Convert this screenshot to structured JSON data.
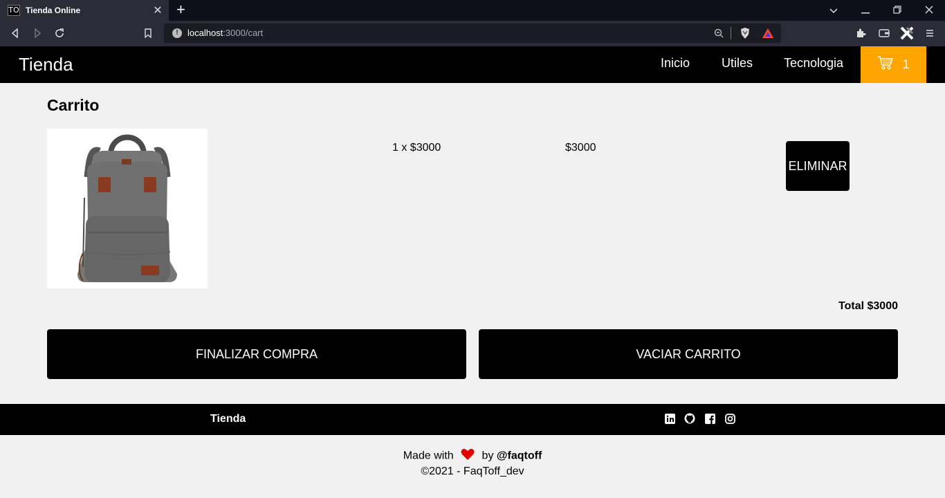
{
  "browser": {
    "tab_favicon": "TO",
    "tab_title": "Tienda Online",
    "url_host": "localhost",
    "url_path": ":3000/cart"
  },
  "header": {
    "brand": "Tienda",
    "nav": [
      "Inicio",
      "Utiles",
      "Tecnologia"
    ],
    "cart_count": "1",
    "cart_color": "#ffa500"
  },
  "cart": {
    "title": "Carrito",
    "items": [
      {
        "image": "gray-backpack",
        "quantity_price": "1 x $3000",
        "line_total": "$3000",
        "remove_label": "ELIMINAR"
      }
    ],
    "total": "Total $3000",
    "checkout_label": "FINALIZAR COMPRA",
    "clear_label": "VACIAR CARRITO"
  },
  "footer": {
    "brand": "Tienda",
    "social_icons": [
      "linkedin-icon",
      "github-icon",
      "facebook-icon",
      "instagram-icon"
    ],
    "made_with": "Made with",
    "by": "by",
    "author": "@faqtoff",
    "copyright": "©2021 - FaqToff_dev",
    "heart_color": "#e00000"
  }
}
